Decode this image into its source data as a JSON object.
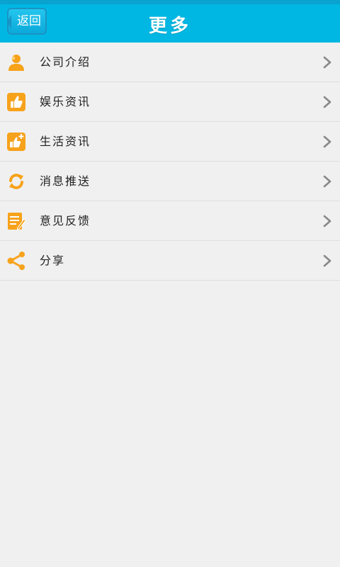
{
  "header": {
    "back_label": "返回",
    "title": "更多"
  },
  "menu": [
    {
      "label": "公司介绍",
      "icon": "user-icon"
    },
    {
      "label": "娱乐资讯",
      "icon": "thumbs-up-icon"
    },
    {
      "label": "生活资讯",
      "icon": "thumbs-up-plus-icon"
    },
    {
      "label": "消息推送",
      "icon": "refresh-icon"
    },
    {
      "label": "意见反馈",
      "icon": "edit-note-icon"
    },
    {
      "label": "分享",
      "icon": "share-icon"
    }
  ],
  "colors": {
    "header_bg": "#00b7e3",
    "accent": "#f7a21b",
    "page_bg": "#f0f0f0"
  }
}
